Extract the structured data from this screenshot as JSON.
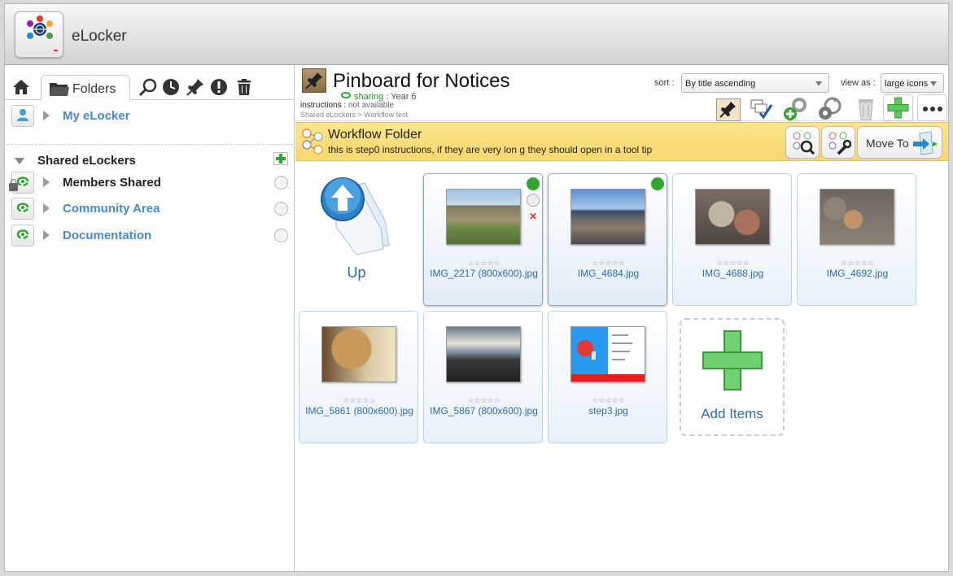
{
  "app": {
    "title": "eLocker"
  },
  "left": {
    "folders_tab": "Folders",
    "my_elocker": "My eLocker",
    "shared_header": "Shared eLockers",
    "shared_items": [
      {
        "label": "Members Shared"
      },
      {
        "label": "Community Area"
      },
      {
        "label": "Documentation"
      }
    ]
  },
  "folder": {
    "title": "Pinboard for Notices",
    "sharing_label": "sharing",
    "sharing_value": "Year 6",
    "instructions_label": "instructions",
    "instructions_value": "not available",
    "breadcrumb": "Shared eLockers > Workflow test"
  },
  "controls": {
    "sort_label": "sort :",
    "sort_value": "By title ascending",
    "view_label": "view as :",
    "view_value": "large icons"
  },
  "workflow": {
    "title": "Workflow Folder",
    "description": "this is step0 instructions, if they are very lon g they should open in a tool tip",
    "move_to": "Move To"
  },
  "grid": {
    "up_label": "Up",
    "add_label": "Add Items",
    "rating_stars": "☆☆☆☆☆",
    "items": [
      {
        "name": "IMG_2217 (800x600).jpg"
      },
      {
        "name": "IMG_4684.jpg"
      },
      {
        "name": "IMG_4688.jpg"
      },
      {
        "name": "IMG_4692.jpg"
      },
      {
        "name": "IMG_5861 (800x600).jpg"
      },
      {
        "name": "IMG_5867 (800x600).jpg"
      },
      {
        "name": "step3.jpg"
      }
    ]
  },
  "colors": {
    "link": "#2e6da4",
    "workflow_bar": "#fde68a",
    "tile_border": "#b8d4ea",
    "green_plus": "#5cc85c"
  }
}
